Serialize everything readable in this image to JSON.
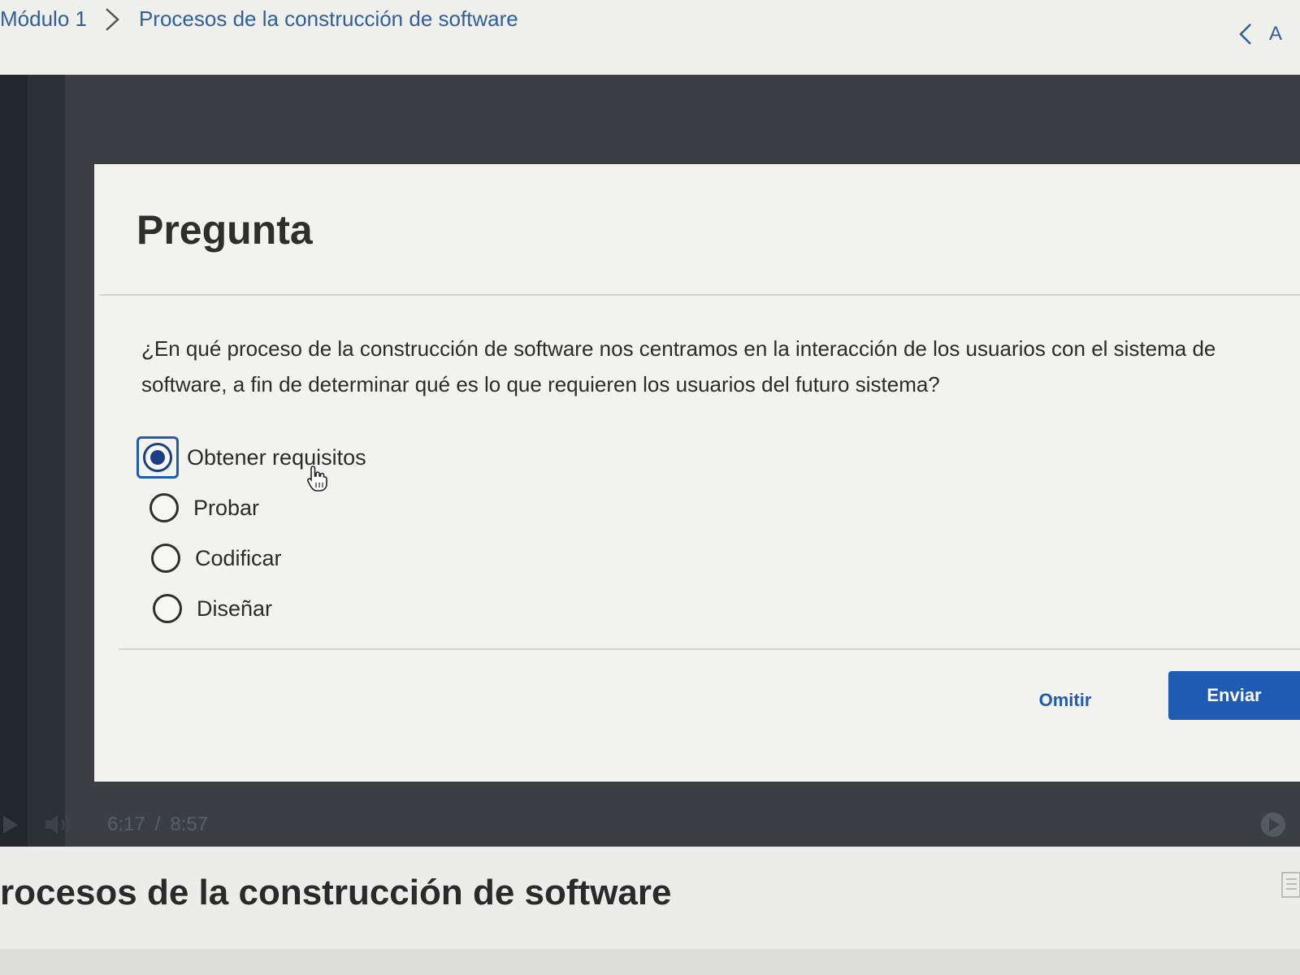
{
  "breadcrumb": {
    "module": "Módulo 1",
    "current": "Procesos de la construcción de software"
  },
  "nav": {
    "prev_label": "A"
  },
  "question": {
    "title": "Pregunta",
    "text": "¿En qué proceso de la construcción de software nos centramos en la interacción de los usuarios con el sistema de software, a fin de determinar qué es lo que requieren los usuarios del futuro sistema?",
    "options": [
      {
        "label": "Obtener requisitos",
        "selected": true
      },
      {
        "label": "Probar",
        "selected": false
      },
      {
        "label": "Codificar",
        "selected": false
      },
      {
        "label": "Diseñar",
        "selected": false
      }
    ],
    "skip_label": "Omitir",
    "submit_label": "Enviar"
  },
  "player": {
    "time_current": "6:17",
    "time_separator": "/",
    "time_total": "8:57"
  },
  "page": {
    "heading": "rocesos de la construcción de software"
  },
  "colors": {
    "accent": "#1f5bb5",
    "link": "#2f5f9c",
    "player_bg": "#3b3f44",
    "card_bg": "#f2f2ef"
  },
  "icons": {
    "breadcrumb_separator": "chevron-right-icon",
    "nav_prev": "chevron-left-icon",
    "cursor": "hand-pointer-icon",
    "play": "play-icon",
    "volume": "volume-icon",
    "fullscreen": "fullscreen-icon",
    "transcript": "transcript-icon"
  }
}
